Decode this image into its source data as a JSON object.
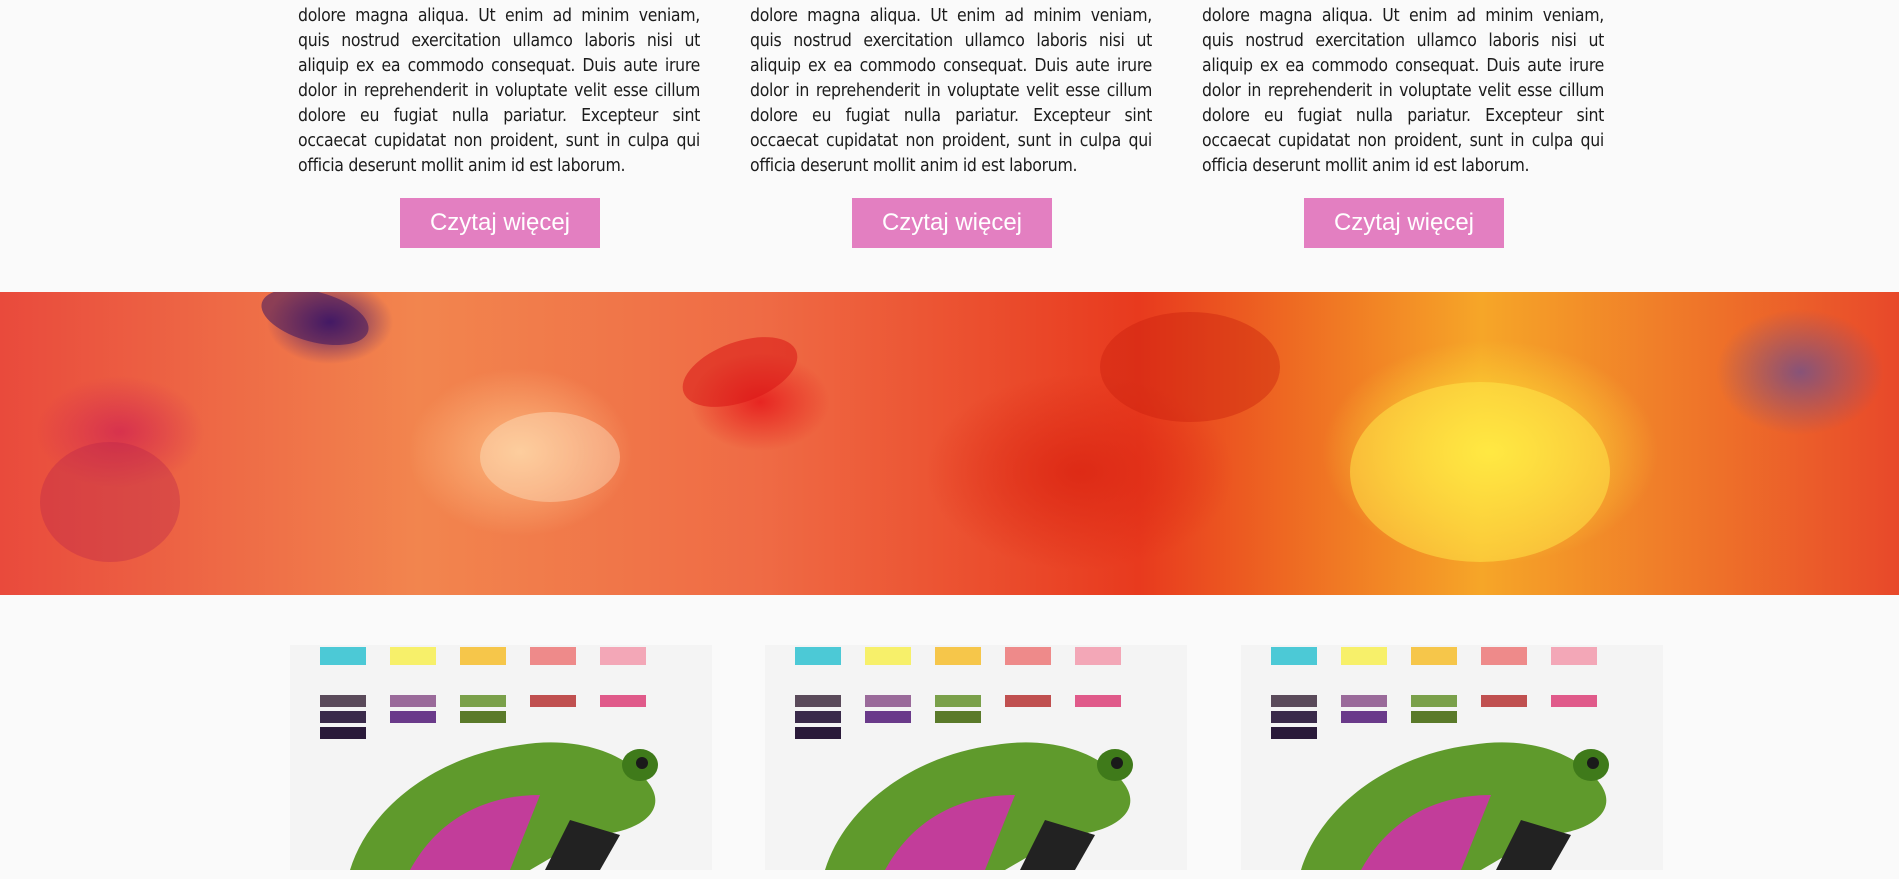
{
  "columns": [
    {
      "text": "dolore magna aliqua. Ut enim ad minim veniam, quis nostrud exercitation ullamco laboris nisi ut aliquip ex ea commodo consequat. Duis aute irure dolor in reprehenderit in voluptate velit esse cillum dolore eu fugiat nulla pariatur. Excepteur sint occaecat cupidatat non proident, sunt in culpa qui officia deserunt mollit anim id est laborum.",
      "button_label": "Czytaj więcej"
    },
    {
      "text": "dolore magna aliqua. Ut enim ad minim veniam, quis nostrud exercitation ullamco laboris nisi ut aliquip ex ea commodo consequat. Duis aute irure dolor in reprehenderit in voluptate velit esse cillum dolore eu fugiat nulla pariatur. Excepteur sint occaecat cupidatat non proident, sunt in culpa qui officia deserunt mollit anim id est laborum.",
      "button_label": "Czytaj więcej"
    },
    {
      "text": "dolore magna aliqua. Ut enim ad minim veniam, quis nostrud exercitation ullamco laboris nisi ut aliquip ex ea commodo consequat. Duis aute irure dolor in reprehenderit in voluptate velit esse cillum dolore eu fugiat nulla pariatur. Excepteur sint occaecat cupidatat non proident, sunt in culpa qui officia deserunt mollit anim id est laborum.",
      "button_label": "Czytaj więcej"
    }
  ],
  "colors": {
    "button_bg": "#e37fc1",
    "button_text": "#ffffff",
    "page_bg": "#fafafa"
  }
}
